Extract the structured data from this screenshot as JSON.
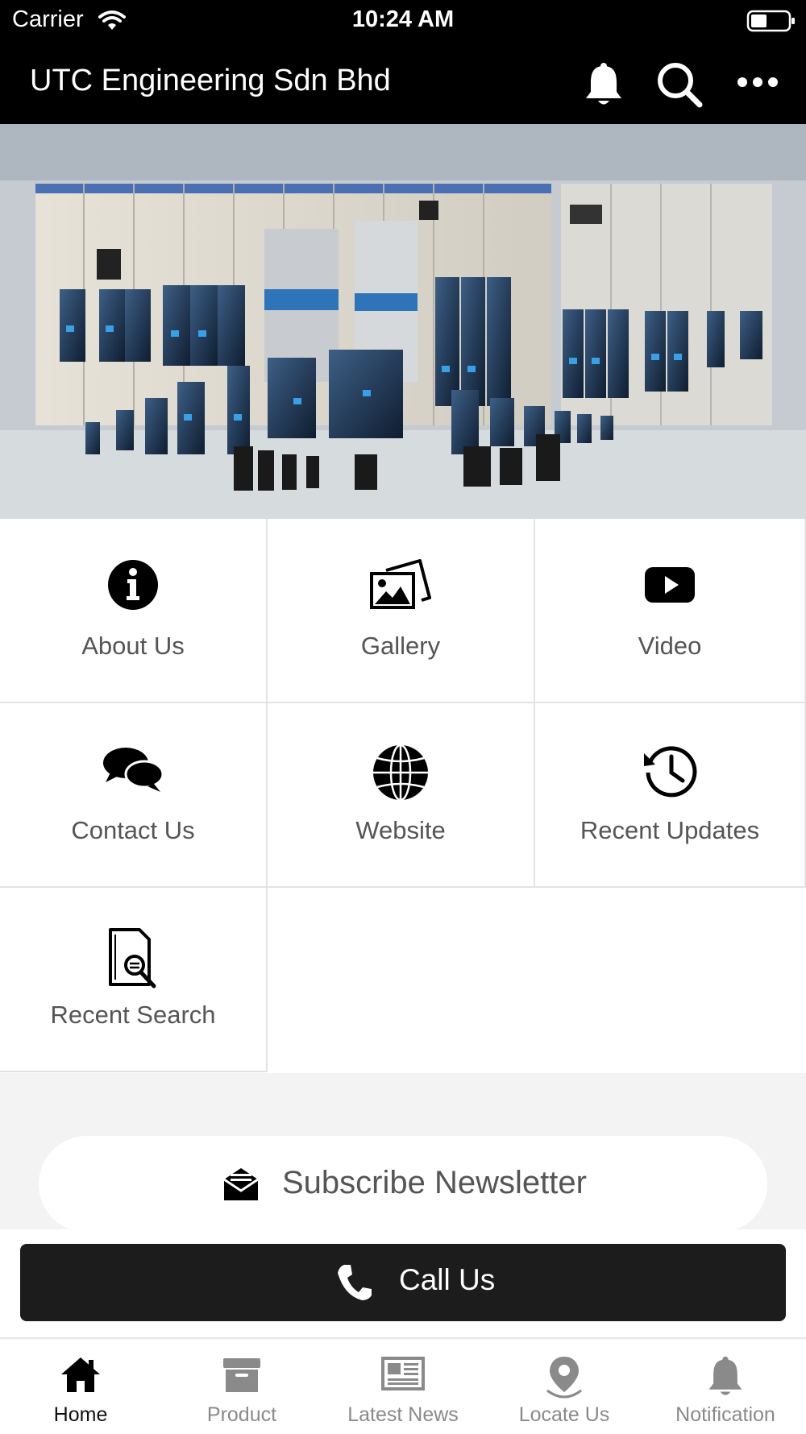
{
  "status_bar": {
    "carrier": "Carrier",
    "time": "10:24 AM"
  },
  "nav": {
    "title": "UTC Engineering Sdn Bhd",
    "icons": [
      "bell-icon",
      "search-icon",
      "more-icon"
    ]
  },
  "menu": {
    "items": [
      {
        "label": "About Us",
        "icon": "info-icon"
      },
      {
        "label": "Gallery",
        "icon": "gallery-icon"
      },
      {
        "label": "Video",
        "icon": "youtube-icon"
      },
      {
        "label": "Contact Us",
        "icon": "chat-bubbles-icon"
      },
      {
        "label": "Website",
        "icon": "globe-icon"
      },
      {
        "label": "Recent Updates",
        "icon": "history-icon"
      },
      {
        "label": "Recent Search",
        "icon": "document-search-icon"
      }
    ]
  },
  "subscribe": {
    "label": "Subscribe Newsletter",
    "icon": "envelope-icon"
  },
  "call": {
    "label": "Call Us",
    "icon": "phone-icon"
  },
  "tabs": [
    {
      "label": "Home",
      "icon": "home-icon",
      "active": true
    },
    {
      "label": "Product",
      "icon": "archive-box-icon",
      "active": false
    },
    {
      "label": "Latest News",
      "icon": "newspaper-icon",
      "active": false
    },
    {
      "label": "Locate Us",
      "icon": "map-pin-icon",
      "active": false
    },
    {
      "label": "Notification",
      "icon": "bell-icon",
      "active": false
    }
  ],
  "colors": {
    "bar": "#000000",
    "call_button": "#1c1c1c",
    "label_text": "#555555",
    "inactive_tab": "#8a8a8a"
  }
}
